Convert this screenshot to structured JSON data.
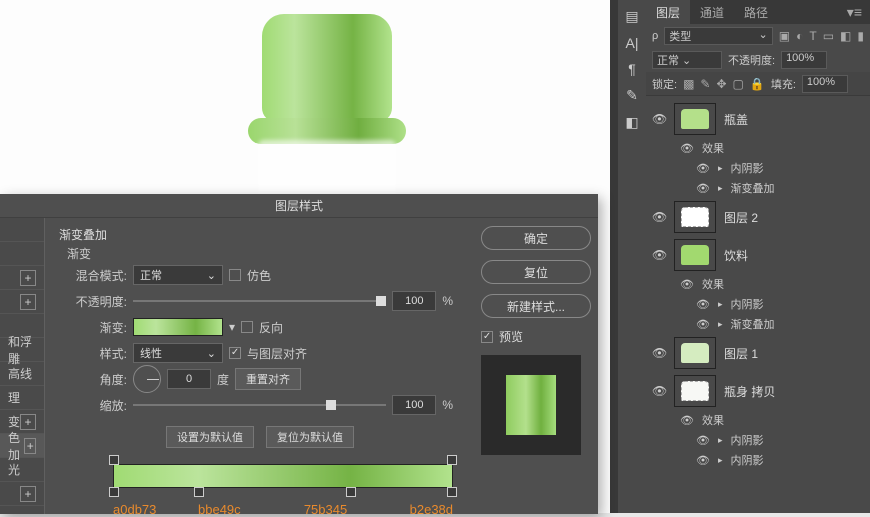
{
  "dialog": {
    "title": "图层样式",
    "sectionTitle": "渐变叠加",
    "subTitle": "渐变",
    "blendMode": {
      "label": "混合模式:",
      "value": "正常",
      "ditherLabel": "仿色"
    },
    "opacity": {
      "label": "不透明度:",
      "value": "100",
      "unit": "%"
    },
    "gradient": {
      "label": "渐变:",
      "reverseLabel": "反向"
    },
    "style": {
      "label": "样式:",
      "value": "线性",
      "alignLabel": "与图层对齐"
    },
    "angle": {
      "label": "角度:",
      "value": "0",
      "unit": "度",
      "resetBtn": "重置对齐"
    },
    "scale": {
      "label": "缩放:",
      "value": "100",
      "unit": "%"
    },
    "setDefaultBtn": "设置为默认值",
    "resetDefaultBtn": "复位为默认值",
    "leftItems": [
      "",
      "",
      "",
      "",
      "",
      "和浮雕",
      "高线",
      "理",
      "变",
      "色加",
      "光",
      ""
    ],
    "okBtn": "确定",
    "cancelBtn": "复位",
    "newStyleBtn": "新建样式...",
    "previewLabel": "预览"
  },
  "chart_data": {
    "type": "gradient",
    "stops": [
      {
        "position": 0,
        "hex": "a0db73"
      },
      {
        "position": 25,
        "hex": "bbe49c"
      },
      {
        "position": 70,
        "hex": "75b345"
      },
      {
        "position": 100,
        "hex": "b2e38d"
      }
    ]
  },
  "panel": {
    "tabs": [
      "图层",
      "通道",
      "路径"
    ],
    "kindLabel": "类型",
    "blendMode": "正常",
    "opacityLabel": "不透明度:",
    "opacityVal": "100%",
    "lockLabel": "锁定:",
    "fillLabel": "填充:",
    "fillVal": "100%",
    "layers": [
      {
        "name": "瓶盖",
        "effects": "效果",
        "fx": [
          "内阴影",
          "渐变叠加"
        ],
        "thumbColor": "#b4e08a"
      },
      {
        "name": "图层 2",
        "thumbColor": "#ffffff"
      },
      {
        "name": "饮料",
        "effects": "效果",
        "fx": [
          "内阴影",
          "渐变叠加"
        ],
        "thumbColor": "#a2d96f"
      },
      {
        "name": "图层 1",
        "thumbColor": "#d5ecc0"
      },
      {
        "name": "瓶身 拷贝",
        "effects": "效果",
        "fx": [
          "内阴影",
          "内阴影"
        ],
        "thumbColor": "#f7f8f5"
      }
    ]
  }
}
